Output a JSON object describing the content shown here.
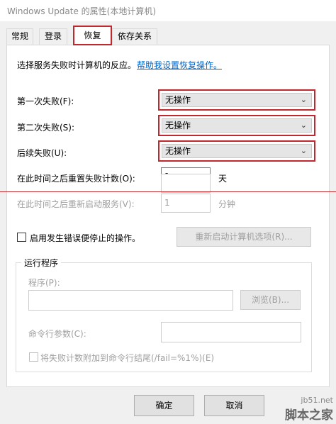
{
  "window": {
    "title": "Windows Update 的属性(本地计算机)"
  },
  "tabs": [
    {
      "label": "常规"
    },
    {
      "label": "登录"
    },
    {
      "label": "恢复"
    },
    {
      "label": "依存关系"
    }
  ],
  "recovery": {
    "intro": "选择服务失败时计算机的反应。",
    "help_link": "帮助我设置恢复操作。",
    "first_failure_label": "第一次失败(F):",
    "first_failure_value": "无操作",
    "second_failure_label": "第二次失败(S):",
    "second_failure_value": "无操作",
    "subsequent_failure_label": "后续失败(U):",
    "subsequent_failure_value": "无操作",
    "reset_count_label": "在此时间之后重置失败计数(O):",
    "reset_count_value": "1",
    "reset_count_unit": "天",
    "restart_service_label": "在此时间之后重新启动服务(V):",
    "restart_service_value": "1",
    "restart_service_unit": "分钟",
    "enable_actions_label": "启用发生错误便停止的操作。",
    "restart_computer_button": "重新启动计算机选项(R)...",
    "run_program": {
      "group_title": "运行程序",
      "program_label": "程序(P):",
      "browse_button": "浏览(B)...",
      "params_label": "命令行参数(C):",
      "append_fail_label": "将失败计数附加到命令行结尾(/fail=%1%)(E)"
    }
  },
  "footer": {
    "ok_button": "确定",
    "cancel_button": "取消"
  },
  "watermark": {
    "url": "jb51.net",
    "name": "脚本之家"
  },
  "colors": {
    "highlight_red": "#c0282d",
    "link_blue": "#0066cc",
    "disabled_text": "#a0a0a0"
  }
}
